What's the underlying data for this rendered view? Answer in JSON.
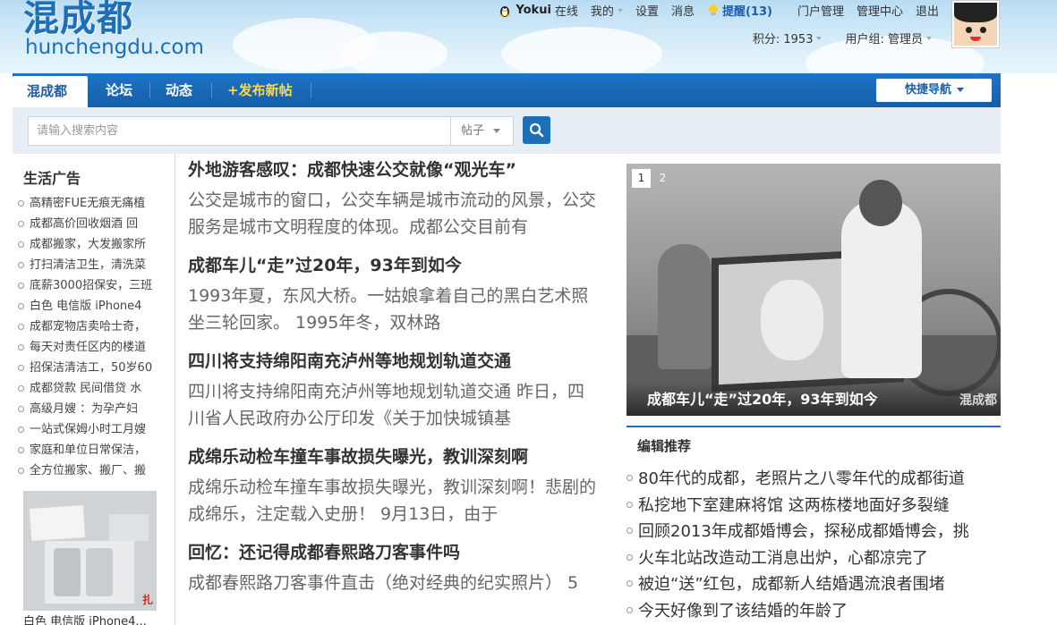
{
  "site": {
    "logo_cn": "混成都",
    "logo_en": "hunchengdu.com"
  },
  "userbar": {
    "username": "Yokui",
    "status": "在线",
    "mine": "我的",
    "settings": "设置",
    "messages": "消息",
    "remind": "提醒(13)",
    "portal_admin": "门户管理",
    "admin_center": "管理中心",
    "logout": "退出",
    "points": "积分: 1953",
    "usergroup": "用户组: 管理员"
  },
  "nav": {
    "tabs": [
      {
        "label": "混成都"
      },
      {
        "label": "论坛"
      },
      {
        "label": "动态"
      },
      {
        "label": "+发布新帖"
      }
    ],
    "quick": "快捷导航"
  },
  "search": {
    "placeholder": "请输入搜索内容",
    "type": "帖子"
  },
  "left": {
    "heading": "生活广告",
    "items": [
      "高精密FUE无痕无痛植",
      "成都高价回收烟酒 回",
      "成都搬家，大发搬家所",
      "打扫清洁卫生，清洗菜",
      "底薪3000招保安，三班",
      "白色 电信版 iPhone4",
      "成都宠物店卖哈士奇，",
      "每天对责任区内的楼道",
      "招保洁清洁工，50岁60",
      "成都贷款 民间借贷 水",
      "高级月嫂 ：为孕产妇",
      "一站式保姆小时工月嫂",
      "家庭和单位日常保洁，",
      "全方位搬家、搬厂、搬"
    ],
    "thumb_caption": "白色 电信版 iPhone4...",
    "thumb_watermark": "扎"
  },
  "articles": [
    {
      "title": "外地游客感叹：成都快速公交就像“观光车”",
      "summary": "公交是城市的窗口，公交车辆是城市流动的风景，公交服务是城市文明程度的体现。成都公交目前有"
    },
    {
      "title": "成都车儿“走”过20年，93年到如今",
      "summary": "1993年夏，东风大桥。一姑娘拿着自己的黑白艺术照坐三轮回家。 1995年冬，双林路"
    },
    {
      "title": "四川将支持绵阳南充泸州等地规划轨道交通",
      "summary": "四川将支持绵阳南充泸州等地规划轨道交通 昨日，四川省人民政府办公厅印发《关于加快城镇基"
    },
    {
      "title": "成绵乐动检车撞车事故损失曝光，教训深刻啊",
      "summary": "成绵乐动检车撞车事故损失曝光，教训深刻啊！悲剧的成绵乐，注定载入史册！ 9月13日，由于"
    },
    {
      "title": "回忆：还记得成都春熙路刀客事件吗",
      "summary": "成都春熙路刀客事件直击（绝对经典的纪实照片） 5"
    }
  ],
  "slider": {
    "pages": [
      "1",
      "2"
    ],
    "caption": "成都车儿“走”过20年，93年到如今",
    "watermark": "混成都"
  },
  "recommend": {
    "heading": "编辑推荐",
    "items": [
      "80年代的成都，老照片之八零年代的成都街道",
      "私挖地下室建麻将馆 这两栋楼地面好多裂缝",
      "回顾2013年成都婚博会，探秘成都婚博会，挑",
      "火车北站改造动工消息出炉，心都凉完了",
      "被迫“送”红包，成都新人结婚遇流浪者围堵",
      "今天好像到了该结婚的年龄了"
    ]
  },
  "colors": {
    "brand_blue": "#1d6fb8",
    "post_yellow": "#ffd84a"
  }
}
